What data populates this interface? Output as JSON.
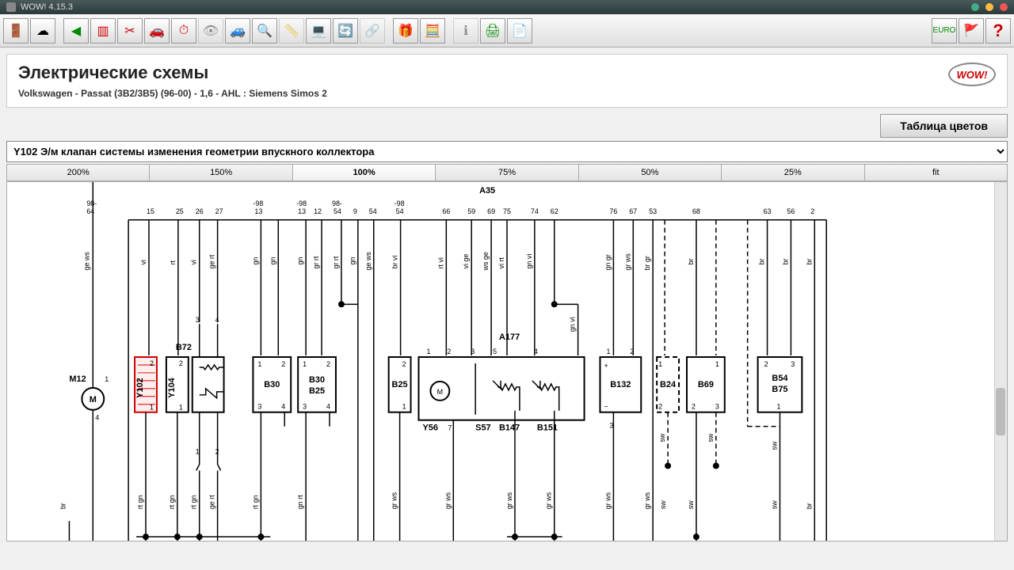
{
  "window": {
    "title": "WOW! 4.15.3"
  },
  "page": {
    "title": "Электрические схемы",
    "vehicle": "Volkswagen - Passat (3B2/3B5) (96-00) - 1,6 - AHL : Siemens Simos 2"
  },
  "buttons": {
    "color_table": "Таблица цветов"
  },
  "dropdown": {
    "selected": "Y102  Э/м клапан системы изменения геометрии впускного коллектора"
  },
  "zoom": {
    "levels": [
      "200%",
      "150%",
      "100%",
      "75%",
      "50%",
      "25%",
      "fit"
    ],
    "active": "100%"
  },
  "toolbar_icons": [
    "exit-icon",
    "weather-icon",
    "back-icon",
    "diag-icon",
    "wrench-icon",
    "car-icon",
    "clock-icon",
    "view-icon",
    "search-car-icon",
    "search-icon",
    "measure-icon",
    "laptop-icon",
    "sync-icon",
    "link-icon",
    "parts-icon",
    "calc-icon",
    "info-icon",
    "print-icon",
    "doc-icon",
    "euro-icon",
    "flag-icon",
    "help-icon"
  ],
  "diagram": {
    "bus_label": "A35",
    "pins_top": [
      "98-64",
      "15",
      "25",
      "26",
      "27",
      "-98 13",
      "-98 13",
      "12",
      "98-54",
      "9",
      "54",
      "-98 54",
      "66",
      "59",
      "69",
      "75",
      "74",
      "62",
      "76",
      "67",
      "53",
      "68",
      "63",
      "56",
      "2"
    ],
    "wire_colors_top": [
      "ge ws",
      "vi",
      "rt",
      "vi",
      "ge rt",
      "gn",
      "gn",
      "gn",
      "gr rt",
      "gr rt",
      "gn",
      "ge ws",
      "br vi",
      "rt vi",
      "vi ge",
      "ws ge",
      "vi rt",
      "gn vi",
      "gn gr",
      "gr ws",
      "br gr",
      "br",
      "br",
      "br",
      "br"
    ],
    "wire_colors_bottom": [
      "br",
      "rt gn",
      "rt gn",
      "rt gn",
      "ge rt",
      "rt gn",
      "gn rt",
      "gr ws",
      "gr ws",
      "gr ws",
      "gr ws",
      "gr ws",
      "sw",
      "sw",
      "sw",
      "sw",
      "br"
    ],
    "components": {
      "m12": {
        "name": "M12",
        "symbol": "M",
        "pins": [
          "1",
          "4"
        ]
      },
      "y102": {
        "name": "Y102",
        "pins": [
          "1",
          "2"
        ]
      },
      "y104": {
        "name": "Y104",
        "pins": [
          "1",
          "2"
        ]
      },
      "b72_group": {
        "name": "B72",
        "pins_top": [
          "3",
          "4"
        ],
        "pins_bottom": [
          "1",
          "2"
        ]
      },
      "b30": {
        "name": "B30",
        "pins": [
          "1",
          "2",
          "3",
          "4"
        ]
      },
      "b30b25": {
        "names": [
          "B30",
          "B25"
        ],
        "pins": [
          "1",
          "2",
          "3",
          "4"
        ]
      },
      "b25": {
        "name": "B25",
        "pins": [
          "1",
          "2"
        ]
      },
      "y56": {
        "name": "Y56",
        "symbol": "M",
        "pin": "7"
      },
      "a177": {
        "name": "A177",
        "pins": [
          "1",
          "2",
          "3",
          "5",
          "4"
        ]
      },
      "s57": "S57",
      "b147": "B147",
      "b151": "B151",
      "b132": {
        "name": "B132",
        "pins_top": [
          "1",
          "2"
        ],
        "pin_plus": "+",
        "pin_minus": "−",
        "pin_bottom": "3"
      },
      "b24": {
        "name": "B24",
        "pins": [
          "1",
          "2"
        ]
      },
      "b69": {
        "name": "B69",
        "pins": [
          "1",
          "2",
          "3"
        ]
      },
      "b54b75": {
        "names": [
          "B54",
          "B75"
        ],
        "pins": [
          "2",
          "3",
          "1"
        ]
      },
      "gn_vi": "gn vi"
    }
  }
}
